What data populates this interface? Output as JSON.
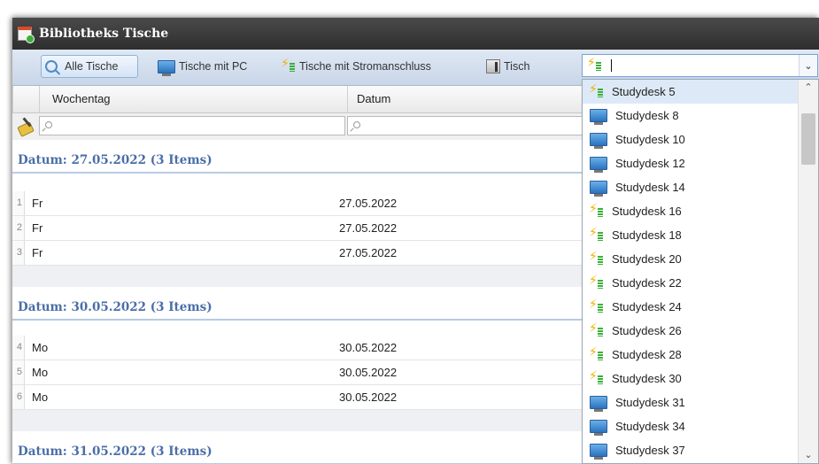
{
  "window": {
    "title": "Bibliotheks Tische"
  },
  "toolbar": {
    "buttons": [
      {
        "label": "Alle Tische",
        "icon": "search-icon",
        "active": true
      },
      {
        "label": "Tische mit PC",
        "icon": "pc-icon"
      },
      {
        "label": "Tische mit Stromanschluss",
        "icon": "power-outlet-icon"
      },
      {
        "label": "Tisch",
        "icon": "desk-icon"
      }
    ],
    "combo": {
      "value": "",
      "icon": "power-outlet-icon"
    }
  },
  "grid": {
    "columns": [
      "Wochentag",
      "Datum"
    ],
    "groups": [
      {
        "header": "Datum: 27.05.2022 (3 Items)",
        "rows": [
          {
            "num": "1",
            "day": "Fr",
            "date": "27.05.2022"
          },
          {
            "num": "2",
            "day": "Fr",
            "date": "27.05.2022"
          },
          {
            "num": "3",
            "day": "Fr",
            "date": "27.05.2022"
          }
        ]
      },
      {
        "header": "Datum: 30.05.2022 (3 Items)",
        "rows": [
          {
            "num": "4",
            "day": "Mo",
            "date": "30.05.2022"
          },
          {
            "num": "5",
            "day": "Mo",
            "date": "30.05.2022"
          },
          {
            "num": "6",
            "day": "Mo",
            "date": "30.05.2022"
          }
        ]
      },
      {
        "header": "Datum: 31.05.2022 (3 Items)",
        "rows": []
      }
    ]
  },
  "dropdown": {
    "items": [
      {
        "label": "Studydesk 5",
        "icon": "power-outlet-icon",
        "selected": true
      },
      {
        "label": "Studydesk 8",
        "icon": "pc-icon"
      },
      {
        "label": "Studydesk 10",
        "icon": "pc-icon"
      },
      {
        "label": "Studydesk 12",
        "icon": "pc-icon"
      },
      {
        "label": "Studydesk 14",
        "icon": "pc-icon"
      },
      {
        "label": "Studydesk 16",
        "icon": "power-outlet-icon"
      },
      {
        "label": "Studydesk 18",
        "icon": "power-outlet-icon"
      },
      {
        "label": "Studydesk 20",
        "icon": "power-outlet-icon"
      },
      {
        "label": "Studydesk 22",
        "icon": "power-outlet-icon"
      },
      {
        "label": "Studydesk 24",
        "icon": "power-outlet-icon"
      },
      {
        "label": "Studydesk 26",
        "icon": "power-outlet-icon"
      },
      {
        "label": "Studydesk 28",
        "icon": "power-outlet-icon"
      },
      {
        "label": "Studydesk 30",
        "icon": "power-outlet-icon"
      },
      {
        "label": "Studydesk 31",
        "icon": "pc-icon"
      },
      {
        "label": "Studydesk 34",
        "icon": "pc-icon"
      },
      {
        "label": "Studydesk 37",
        "icon": "pc-icon"
      }
    ]
  }
}
